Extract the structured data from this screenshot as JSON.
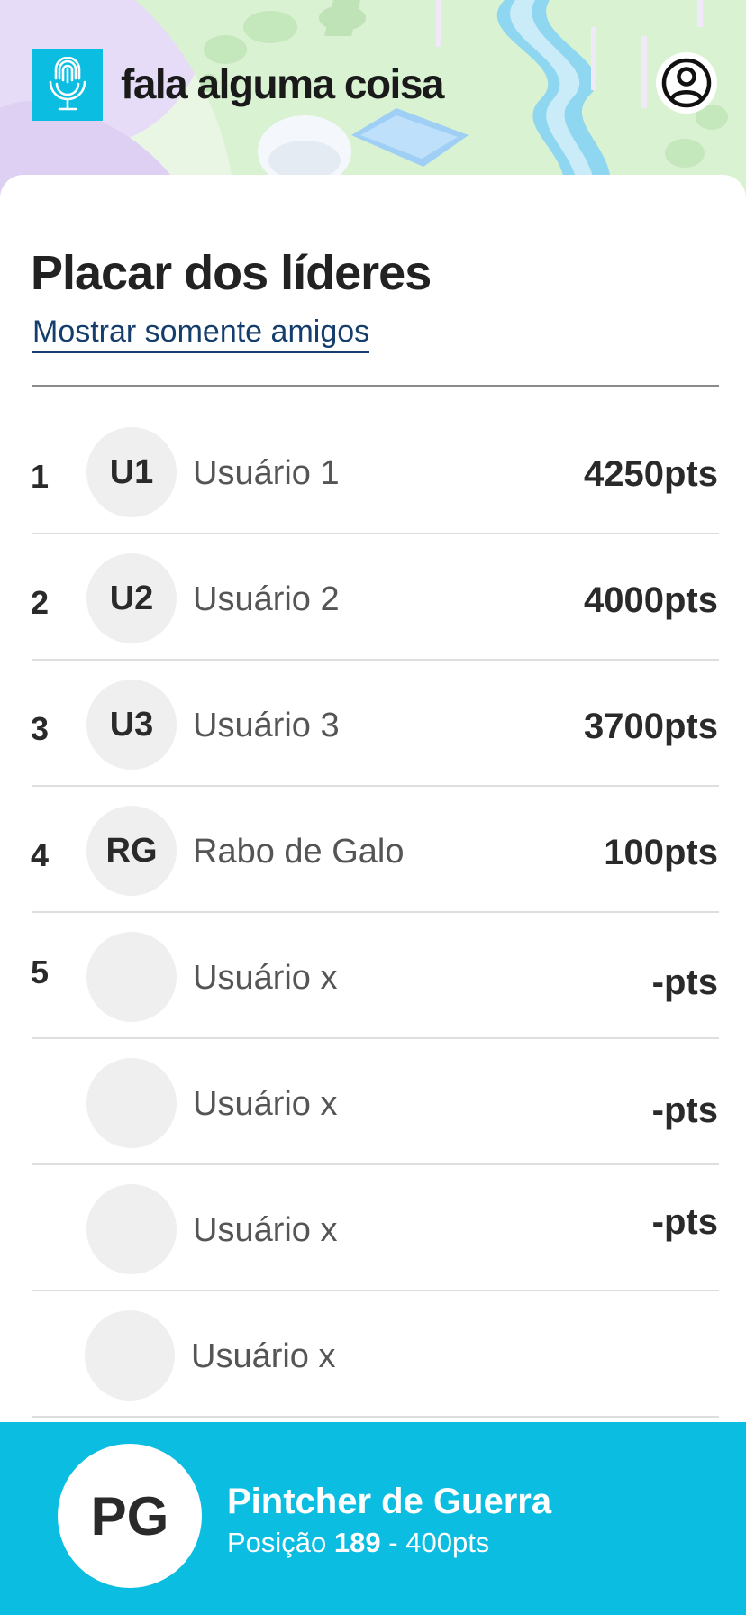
{
  "header": {
    "app_title": "fala alguma coisa",
    "logo_icon": "microphone-fingerprint-icon",
    "profile_icon": "user-circle-icon",
    "accent_color": "#0bbde0"
  },
  "leaderboard": {
    "title": "Placar dos líderes",
    "friends_filter_label": "Mostrar somente amigos",
    "rows": [
      {
        "rank": "1",
        "initials": "U1",
        "name": "Usuário 1",
        "points": "4250pts"
      },
      {
        "rank": "2",
        "initials": "U2",
        "name": "Usuário 2",
        "points": "4000pts"
      },
      {
        "rank": "3",
        "initials": "U3",
        "name": "Usuário 3",
        "points": "3700pts"
      },
      {
        "rank": "4",
        "initials": "RG",
        "name": "Rabo de Galo",
        "points": "100pts"
      },
      {
        "rank": "5",
        "initials": "",
        "name": "Usuário x",
        "points": "-pts"
      },
      {
        "rank": "",
        "initials": "",
        "name": "Usuário x",
        "points": "-pts"
      },
      {
        "rank": "",
        "initials": "",
        "name": "Usuário x",
        "points": "-pts"
      },
      {
        "rank": "",
        "initials": "",
        "name": "Usuário x",
        "points": ""
      }
    ]
  },
  "current_user": {
    "initials": "PG",
    "name": "Pintcher de Guerra",
    "position_label": "Posição",
    "position": "189",
    "separator": "-",
    "points": "400pts"
  }
}
